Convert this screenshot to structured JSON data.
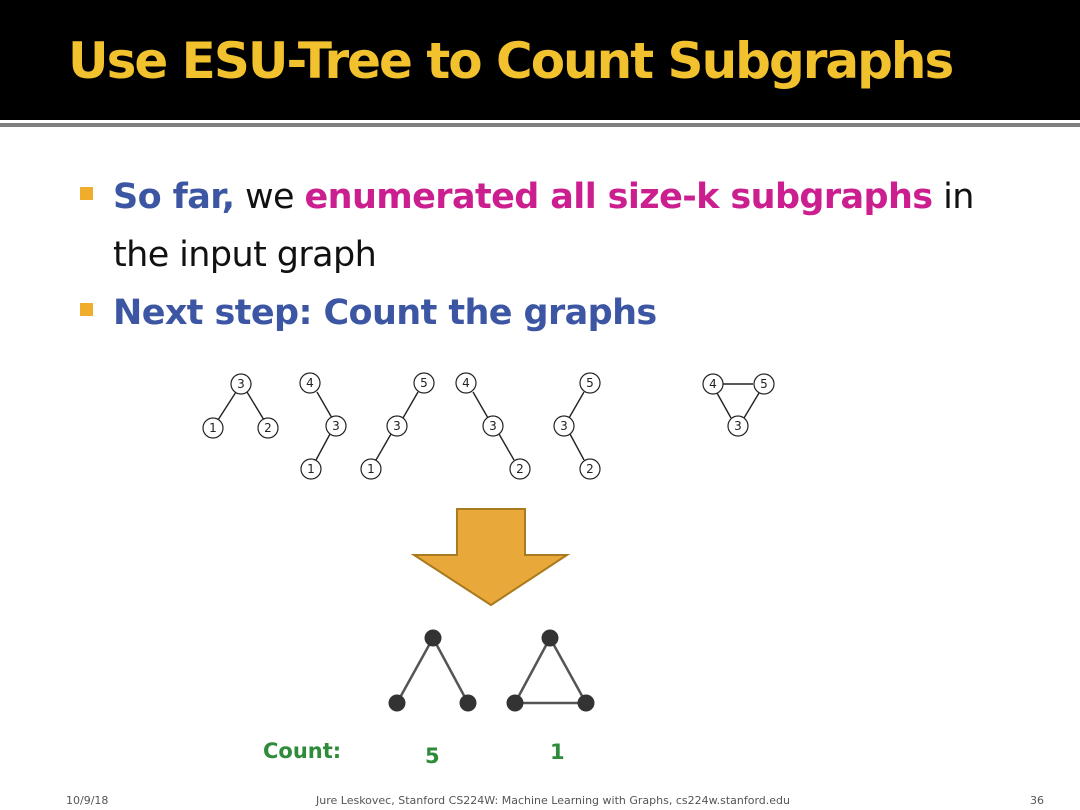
{
  "slide": {
    "title": "Use ESU-Tree to Count Subgraphs",
    "bullets": [
      {
        "parts": [
          "So far,",
          " we ",
          "enumerated all size-k subgraphs",
          " in the input graph"
        ]
      },
      {
        "parts": [
          "Next step: Count the graphs"
        ]
      }
    ],
    "subgraphs": [
      {
        "nodes": [
          "3",
          "1",
          "2"
        ]
      },
      {
        "nodes": [
          "4",
          "3",
          "1"
        ]
      },
      {
        "nodes": [
          "5",
          "3",
          "1"
        ]
      },
      {
        "nodes": [
          "4",
          "3",
          "2"
        ]
      },
      {
        "nodes": [
          "5",
          "3",
          "2"
        ]
      },
      {
        "nodes": [
          "4",
          "5",
          "3"
        ]
      }
    ],
    "counts": {
      "label": "Count:",
      "path_count": "5",
      "triangle_count": "1"
    },
    "footer": {
      "date": "10/9/18",
      "credit": "Jure Leskovec, Stanford CS224W: Machine Learning with Graphs, cs224w.stanford.edu",
      "page": "36"
    },
    "colors": {
      "title": "#f2c12e",
      "emphasis_blue": "#3c56a3",
      "emphasis_pink": "#cc1f8f",
      "arrow": "#e9a93a",
      "count": "#2e8b3a"
    }
  }
}
